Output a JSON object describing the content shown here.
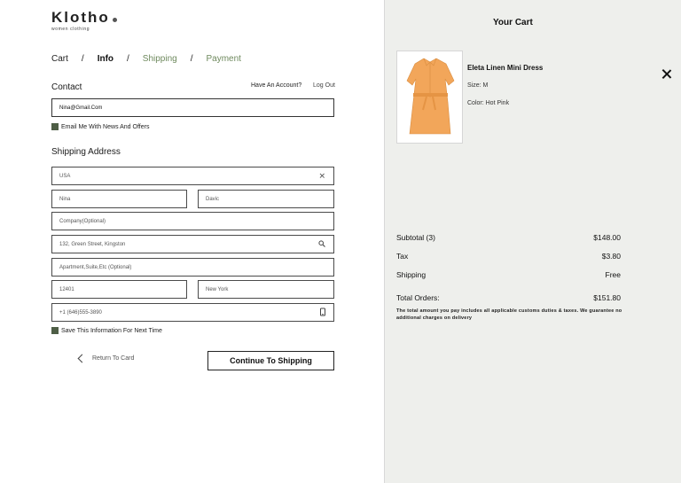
{
  "brand": {
    "name": "Klotho",
    "tagline": "women clothing"
  },
  "breadcrumbs": [
    "Cart",
    "Info",
    "Shipping",
    "Payment"
  ],
  "breadcrumb_separator": "/",
  "contact": {
    "title": "Contact",
    "have_account": "Have An Account?",
    "logout": "Log Out",
    "email_value": "Nina@Gmail.Com",
    "newsletter_label": "Email Me With News And Offers"
  },
  "shipping": {
    "title": "Shipping Address",
    "country": "USA",
    "first_name": "Nina",
    "last_name": "Davic",
    "company_placeholder": "Company(Optional)",
    "address": "132, Green Street, Kingston",
    "apartment_placeholder": "Apartment,Suite,Etc (Optional)",
    "zip": "12401",
    "city": "New York",
    "phone": "+1 (646)555-3890",
    "save_label": "Save This Information For Next Time"
  },
  "actions": {
    "return_label": "Return To Card",
    "continue_label": "Continue To Shipping"
  },
  "cart": {
    "title": "Your Cart",
    "item": {
      "name": "Eleta Linen Mini Dress",
      "size": "Size: M",
      "color": "Color: Hot Pink"
    },
    "subtotal_label": "Subtotal (3)",
    "subtotal_value": "$148.00",
    "tax_label": "Tax",
    "tax_value": "$3.80",
    "shipping_label": "Shipping",
    "shipping_value": "Free",
    "total_label": "Total Orders:",
    "total_value": "$151.80",
    "note": "The total amount you pay includes all applicable customs duties & taxes. We guarantee no additional charges on delivery"
  },
  "colors": {
    "accent_green": "#6f8a5e",
    "checkbox": "#4e5e46",
    "panel_bg": "#eeefec",
    "dress": "#f2a65a"
  },
  "icons": {
    "country_clear": "close-icon",
    "address_search": "search-icon",
    "phone": "mobile-phone-icon",
    "back": "chevron-left-icon",
    "remove_item": "close-icon"
  }
}
